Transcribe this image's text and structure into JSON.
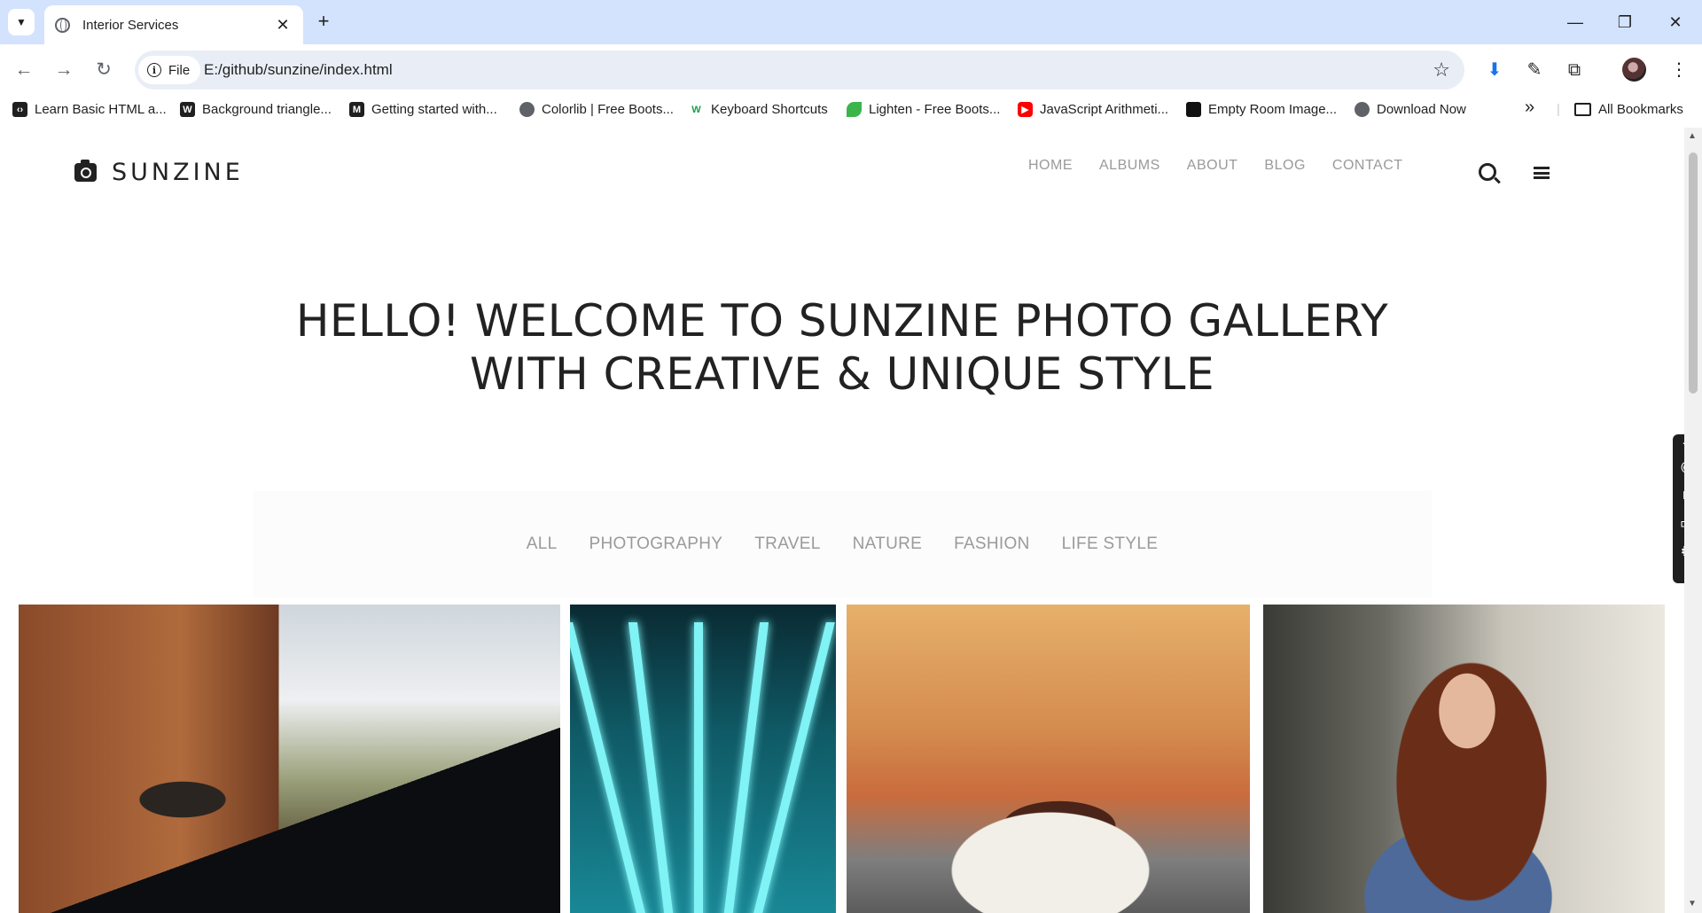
{
  "browser": {
    "tab_title": "Interior Services",
    "tab_close": "✕",
    "new_tab": "+",
    "window_controls": {
      "minimize": "—",
      "restore": "❐",
      "close": "✕"
    },
    "chip_label": "File",
    "url": "E:/github/sunzine/index.html",
    "bookmarks": [
      {
        "label": "Learn Basic HTML a...",
        "icon": "code-icon",
        "color": "#1f1f1f"
      },
      {
        "label": "Background triangle...",
        "icon": "w-icon",
        "color": "#1f1f1f"
      },
      {
        "label": "Getting started with...",
        "icon": "m-icon",
        "color": "#1f1f1f"
      },
      {
        "label": "Colorlib | Free Boots...",
        "icon": "globe-icon",
        "color": "#5f6368"
      },
      {
        "label": "Keyboard Shortcuts",
        "icon": "w-icon",
        "color": "#1a9c4a"
      },
      {
        "label": "Lighten - Free Boots...",
        "icon": "leaf-icon",
        "color": "#3bb54a"
      },
      {
        "label": "JavaScript Arithmeti...",
        "icon": "youtube-icon",
        "color": "#ff0000"
      },
      {
        "label": "Empty Room Image...",
        "icon": "square-icon",
        "color": "#111111"
      },
      {
        "label": "Download Now",
        "icon": "globe-icon",
        "color": "#5f6368"
      }
    ],
    "bookmarks_overflow": "»",
    "all_bookmarks": "All Bookmarks"
  },
  "site": {
    "logo_text": "SUNZINE",
    "nav": [
      "HOME",
      "ALBUMS",
      "ABOUT",
      "BLOG",
      "CONTACT"
    ],
    "hero_line1": "HELLO! WELCOME TO SUNZINE PHOTO GALLERY",
    "hero_line2": "WITH CREATIVE & UNIQUE STYLE",
    "filters": [
      "ALL",
      "PHOTOGRAPHY",
      "TRAVEL",
      "NATURE",
      "FASHION",
      "LIFE STYLE"
    ]
  },
  "colors": {
    "tabstrip": "#d3e3fd",
    "omnibox": "#e9eef6",
    "nav_text": "#9a9a9a",
    "heading": "#222222"
  }
}
